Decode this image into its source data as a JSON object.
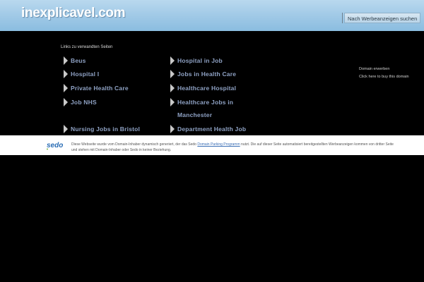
{
  "header": {
    "site_name": "inexplicavel.com",
    "search_button": "Nach Werbeanzeigen suchen"
  },
  "links": {
    "heading": "Links zu verwandten Seiten",
    "items": [
      {
        "label": "Beus"
      },
      {
        "label": "Hospital in Job"
      },
      {
        "label": "Hospital I"
      },
      {
        "label": "Jobs in Health Care"
      },
      {
        "label": "Private Health Care"
      },
      {
        "label": "Healthcare Hospital"
      },
      {
        "label": "Job NHS"
      },
      {
        "label": "Healthcare Jobs in Manchester"
      },
      {
        "label": "Nursing Jobs in Bristol"
      },
      {
        "label": "Department Health Job"
      }
    ]
  },
  "sidebar": {
    "line1": "Domain erwerben",
    "line2": "Click here to buy this domain"
  },
  "footer": {
    "logo_text": "sedo",
    "text_before": "Diese Webseite wurde vom Domain-Inhaber dynamisch generiert, der das Sedo ",
    "link_text": "Domain Parking Programm",
    "text_after": " nutzt. Die auf dieser Seite automatisiert bereitgestellten Werbeanzeigen kommen von dritter Seite und stehen mit Domain-Inhaber oder Sedo in keiner Beziehung."
  },
  "colors": {
    "header_bg": "#9ec8e6",
    "link_color": "#8fa2c4",
    "page_bg": "#000000"
  }
}
